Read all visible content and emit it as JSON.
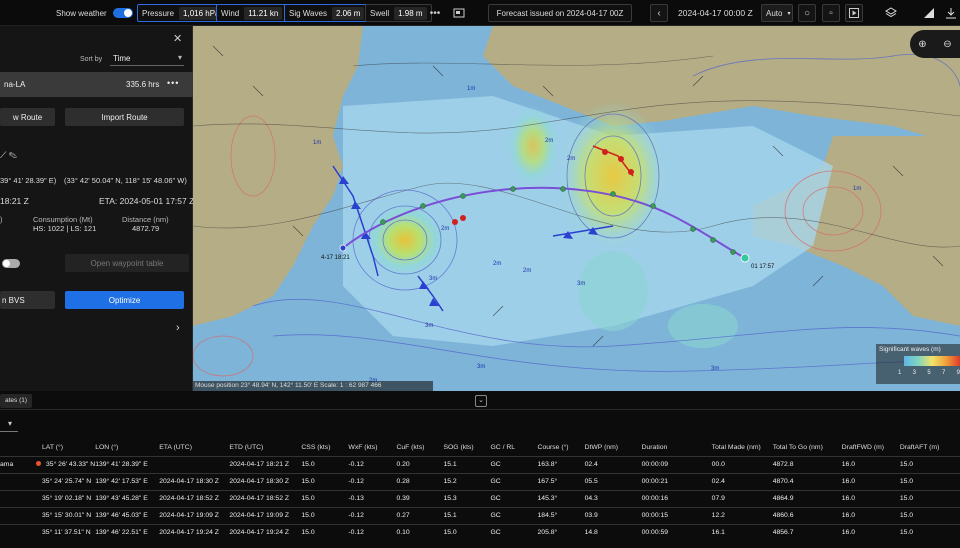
{
  "topbar": {
    "show_weather_label": "Show weather",
    "chips": [
      {
        "label": "Pressure",
        "value": "1,016 hPa"
      },
      {
        "label": "Wind",
        "value": "11.21 kn"
      },
      {
        "label": "Sig Waves",
        "value": "2.06 m"
      },
      {
        "label": "Swell",
        "value": "1.98 m"
      }
    ],
    "forecast_label": "Forecast issued on 2024-04-17 00Z",
    "datetime_value": "2024-04-17 00:00 Z",
    "mode_value": "Auto",
    "icons": [
      "more-icon",
      "frame-icon",
      "chevron-left-icon",
      "chevron-right-icon",
      "record-icon",
      "square-icon",
      "play-icon",
      "layers-icon",
      "signal-icon",
      "download-icon"
    ]
  },
  "panel": {
    "sort_by_label": "Sort by",
    "sort_value": "Time",
    "route_name": "na-LA",
    "route_hours": "335.6 hrs",
    "view_route_label": "w Route",
    "import_route_label": "Import Route",
    "coord_start": "39° 41' 28.39\" E)",
    "coord_end": "(33° 42' 50.04\" N, 118° 15' 48.06\" W)",
    "etd_partial": "18:21 Z",
    "eta_label": "ETA: 2024-05-01 17:57 Z",
    "col_left_label": ")",
    "consumption_label": "Consumption (Mt)",
    "consumption_value": "HS: 1022 | LS: 121",
    "distance_label": "Distance (nm)",
    "distance_value": "4872.79",
    "open_waypoint_label": "Open waypoint table",
    "bvs_label": "n BVS",
    "optimize_label": "Optimize"
  },
  "map": {
    "mouse_position": "Mouse position 23° 48.94' N, 142° 11.50' E   Scale: 1 : 62 987 466",
    "start_label": "4-17 18:21",
    "end_label": "01 17:57",
    "legend_title": "Significant waves (m)",
    "legend_ticks": [
      "1",
      "3",
      "5",
      "7",
      "9"
    ],
    "wave_labels": [
      "2m",
      "3m",
      "2m",
      "1m",
      "2m",
      "3m",
      "3m",
      "1m",
      "2m",
      "3m",
      "2m",
      "1m",
      "3m",
      "2m"
    ]
  },
  "lower": {
    "tab_label": "ates (1)",
    "columns": [
      "",
      "LAT (°)",
      "LON (°)",
      "ETA (UTC)",
      "ETD (UTC)",
      "CSS (kts)",
      "WxF (kts)",
      "CuF (kts)",
      "SOG (kts)",
      "GC / RL",
      "Course (°)",
      "DtWP (nm)",
      "Duration",
      "Total Made (nm)",
      "Total To Go (nm)",
      "DraftFWD (m)",
      "DraftAFT (m)"
    ],
    "rows": [
      [
        "ama",
        "35° 26' 43.33\" N",
        "139° 41' 28.39\" E",
        "",
        "2024-04-17 18:21 Z",
        "15.0",
        "-0.12",
        "0.20",
        "15.1",
        "GC",
        "163.8°",
        "02.4",
        "00:00:09",
        "00.0",
        "4872.8",
        "16.0",
        "15.0"
      ],
      [
        "",
        "35° 24' 25.74\" N",
        "139° 42' 17.53\" E",
        "2024-04-17 18:30 Z",
        "2024-04-17 18:30 Z",
        "15.0",
        "-0.12",
        "0.28",
        "15.2",
        "GC",
        "167.5°",
        "05.5",
        "00:00:21",
        "02.4",
        "4870.4",
        "16.0",
        "15.0"
      ],
      [
        "",
        "35° 19' 02.18\" N",
        "139° 43' 45.28\" E",
        "2024-04-17 18:52 Z",
        "2024-04-17 18:52 Z",
        "15.0",
        "-0.13",
        "0.39",
        "15.3",
        "GC",
        "145.3°",
        "04.3",
        "00:00:16",
        "07.9",
        "4864.9",
        "16.0",
        "15.0"
      ],
      [
        "",
        "35° 15' 30.01\" N",
        "139° 46' 45.03\" E",
        "2024-04-17 19:09 Z",
        "2024-04-17 19:09 Z",
        "15.0",
        "-0.12",
        "0.27",
        "15.1",
        "GC",
        "184.5°",
        "03.9",
        "00:00:15",
        "12.2",
        "4860.6",
        "16.0",
        "15.0"
      ],
      [
        "",
        "35° 11' 37.51\" N",
        "139° 46' 22.51\" E",
        "2024-04-17 19:24 Z",
        "2024-04-17 19:24 Z",
        "15.0",
        "-0.12",
        "0.10",
        "15.0",
        "GC",
        "205.8°",
        "14.8",
        "00:00:59",
        "16.1",
        "4856.7",
        "16.0",
        "15.0"
      ]
    ]
  }
}
